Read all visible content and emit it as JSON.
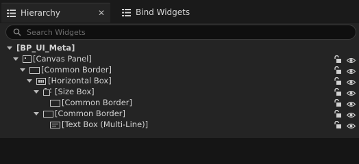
{
  "tabs": [
    {
      "label": "Hierarchy",
      "icon": "list-icon",
      "active": true,
      "close_glyph": "✕"
    },
    {
      "label": "Bind Widgets",
      "icon": "grid-icon",
      "active": false
    }
  ],
  "search": {
    "placeholder": "Search Widgets",
    "value": ""
  },
  "tree": {
    "root": "[BP_UI_Meta]",
    "items": [
      {
        "label": "[Canvas Panel]",
        "icon": "canvas-panel-icon"
      },
      {
        "label": "[Common Border]",
        "icon": "border-icon"
      },
      {
        "label": "[Horizontal Box]",
        "icon": "horizontal-box-icon"
      },
      {
        "label": "[Size Box]",
        "icon": "size-box-icon"
      },
      {
        "label": "[Common Border]",
        "icon": "border-icon"
      },
      {
        "label": "[Common Border]",
        "icon": "border-icon"
      },
      {
        "label": "[Text Box (Multi-Line)]",
        "icon": "text-box-icon"
      }
    ]
  },
  "colors": {
    "panel_bg": "#242424",
    "tab_bar_bg": "#1a1a1a",
    "search_bg": "#0f0f0f",
    "text": "#d2d2d2"
  }
}
